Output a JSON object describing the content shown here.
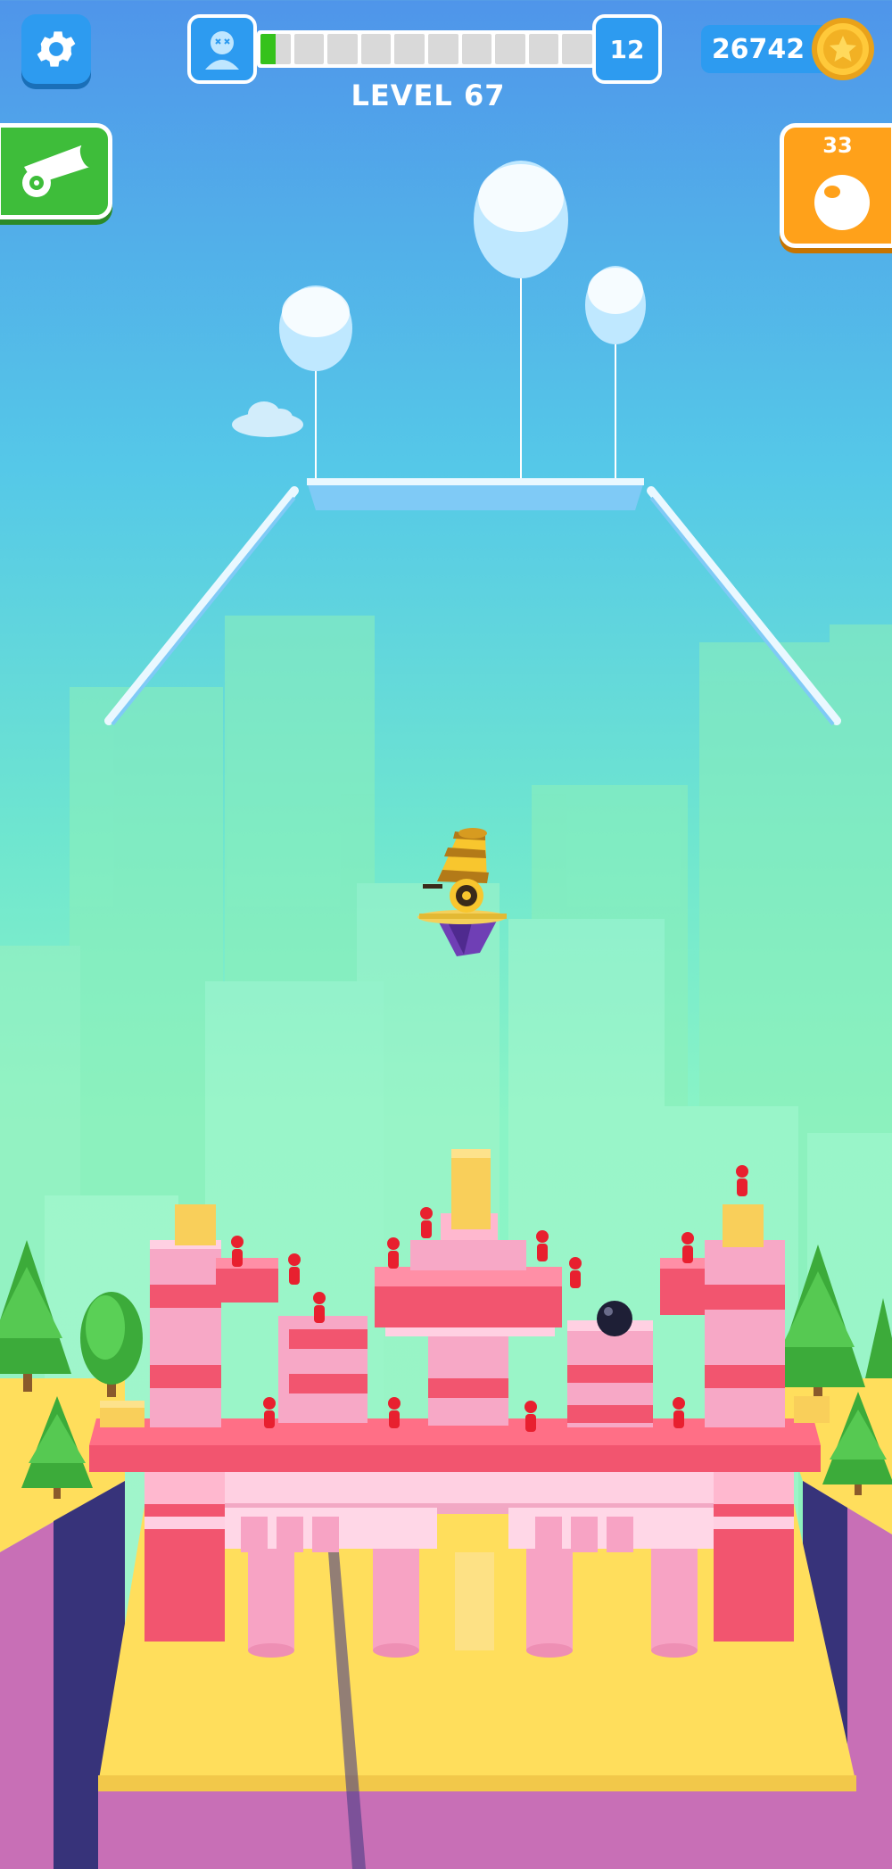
{
  "hud": {
    "level_label": "LEVEL 67",
    "enemies_remaining": "12",
    "coins": "26742",
    "ammo": "33",
    "progress": {
      "segments_total": 10,
      "segments_filled": 0.5
    }
  },
  "icons": {
    "settings": "gear-icon",
    "avatar": "player-avatar-icon",
    "coin": "star-coin-icon",
    "cannon": "cannon-icon",
    "ammo": "cannonball-icon"
  },
  "colors": {
    "hud_blue": "#2d9bf0",
    "progress_green": "#35c21c",
    "cannon_button_green": "#3ebd3a",
    "ammo_button_orange": "#ffa11a",
    "enemy_red": "#e8202f",
    "castle_pink": "#f7a8c6",
    "castle_red": "#f2556f",
    "island_yellow": "#ffde5c"
  }
}
